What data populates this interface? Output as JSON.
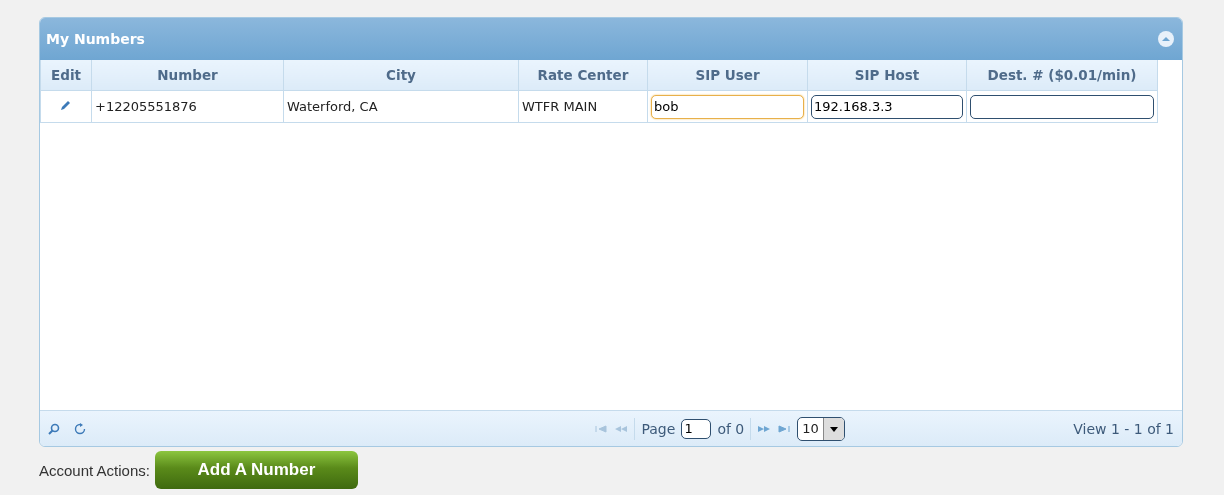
{
  "panel": {
    "title": "My Numbers"
  },
  "table": {
    "columns": [
      "Edit",
      "Number",
      "City",
      "Rate Center",
      "SIP User",
      "SIP Host",
      "Dest. # ($0.01/min)"
    ],
    "rows": [
      {
        "number": "+12205551876",
        "city": "Waterford, CA",
        "rate_center": "WTFR MAIN",
        "sip_user": {
          "value": "bob",
          "focused": true
        },
        "sip_host": {
          "value": "192.168.3.3",
          "focused": false
        },
        "dest": {
          "focused": false
        }
      }
    ]
  },
  "pager": {
    "page_label": "Page",
    "page": "1",
    "of": "of 0",
    "page_size": "10",
    "view": "View 1 - 1 of 1"
  },
  "actions": {
    "label": "Account Actions:",
    "button": "Add A Number"
  }
}
